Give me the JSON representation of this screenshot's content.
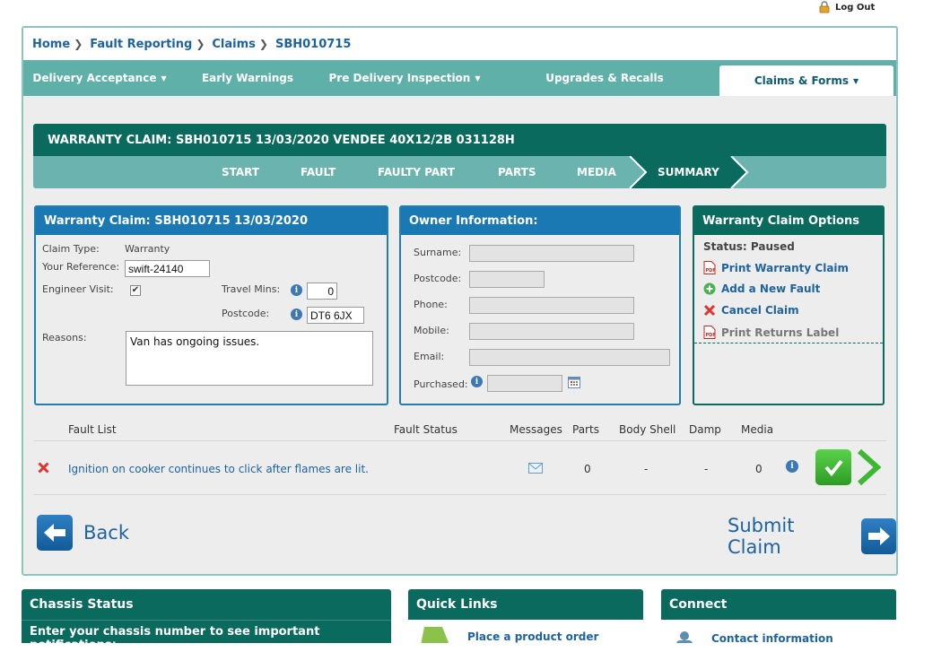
{
  "header": {
    "logout_label": "Log Out"
  },
  "breadcrumb": [
    "Home",
    "Fault Reporting",
    "Claims",
    "SBH010715"
  ],
  "nav": [
    {
      "label": "Delivery Acceptance",
      "dropdown": true
    },
    {
      "label": "Early Warnings",
      "dropdown": false
    },
    {
      "label": "Pre Delivery Inspection",
      "dropdown": true
    },
    {
      "label": "Upgrades & Recalls",
      "dropdown": false
    },
    {
      "label": "Claims & Forms",
      "dropdown": true,
      "active": true
    }
  ],
  "claim_title": "WARRANTY CLAIM: SBH010715 13/03/2020 VENDEE 40X12/2B 031128H",
  "steps": [
    "START",
    "FAULT",
    "FAULTY PART",
    "PARTS",
    "MEDIA",
    "SUMMARY"
  ],
  "active_step": "SUMMARY",
  "warranty_box": {
    "title": "Warranty Claim: SBH010715 13/03/2020",
    "claim_type_label": "Claim Type:",
    "claim_type_value": "Warranty",
    "reference_label": "Your Reference:",
    "reference_value": "swift-24140",
    "engineer_label": "Engineer Visit:",
    "engineer_checked": true,
    "travel_label": "Travel Mins:",
    "travel_value": "0",
    "postcode_label": "Postcode:",
    "postcode_value": "DT6 6JX",
    "reasons_label": "Reasons:",
    "reasons_value": "Van has ongoing issues."
  },
  "owner_box": {
    "title": "Owner Information:",
    "surname_label": "Surname:",
    "postcode_label": "Postcode:",
    "phone_label": "Phone:",
    "mobile_label": "Mobile:",
    "email_label": "Email:",
    "purchased_label": "Purchased:"
  },
  "options_box": {
    "title": "Warranty Claim Options",
    "status": "Status: Paused",
    "print_claim": "Print Warranty Claim",
    "add_fault": "Add a New Fault",
    "cancel_claim": "Cancel Claim",
    "print_returns": "Print Returns Label"
  },
  "fault_table": {
    "headers": [
      "Fault List",
      "Fault Status",
      "Messages",
      "Parts",
      "Body Shell",
      "Damp",
      "Media"
    ],
    "rows": [
      {
        "fault": "Ignition on cooker continues to click after flames are lit.",
        "status": "",
        "parts": "0",
        "body_shell": "-",
        "damp": "-",
        "media": "0"
      }
    ]
  },
  "back_label": "Back",
  "submit_label": "Submit Claim",
  "bottom_panels": {
    "chassis": {
      "title": "Chassis Status",
      "subtitle": "Enter your chassis number to see important notifications:"
    },
    "quick_links": {
      "title": "Quick Links",
      "item": "Place a product order"
    },
    "connect": {
      "title": "Connect",
      "item": "Contact information"
    }
  },
  "colors": {
    "teal_dark": "#0a6a5e",
    "teal_light": "#5fb0a9",
    "blue": "#1a79b2",
    "link": "#1e63a0",
    "green_check": "#3cb832"
  }
}
